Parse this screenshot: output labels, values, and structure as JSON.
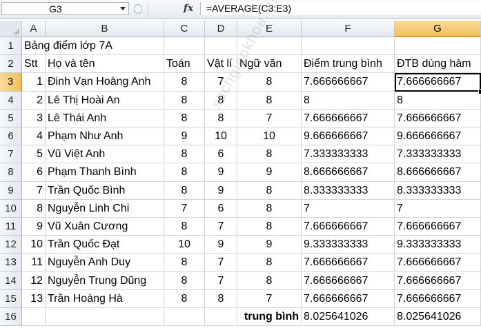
{
  "name_box": {
    "value": "G3"
  },
  "formula_bar": {
    "fx_label": "fx",
    "formula": "=AVERAGE(C3:E3)"
  },
  "columns": [
    "A",
    "B",
    "C",
    "D",
    "E",
    "F",
    "G"
  ],
  "active_column": "G",
  "active_row": 3,
  "rows": [
    {
      "num": "1",
      "cells": [
        "Bảng điểm lớp 7A",
        "",
        "",
        "",
        "",
        "",
        ""
      ]
    },
    {
      "num": "2",
      "cells": [
        "Stt",
        "Họ và tên",
        "Toán",
        "Vật lí",
        "Ngữ văn",
        "Điểm trung bình",
        "ĐTB dùng hàm"
      ]
    },
    {
      "num": "3",
      "cells": [
        "1",
        "Đinh Vạn Hoàng Anh",
        "8",
        "7",
        "8",
        "7.666666667",
        "7.666666667"
      ]
    },
    {
      "num": "4",
      "cells": [
        "2",
        "Lê Thị Hoài An",
        "8",
        "8",
        "8",
        "8",
        "8"
      ]
    },
    {
      "num": "5",
      "cells": [
        "3",
        "Lê Thái Anh",
        "8",
        "8",
        "7",
        "7.666666667",
        "7.666666667"
      ]
    },
    {
      "num": "6",
      "cells": [
        "4",
        "Phạm Như Anh",
        "9",
        "10",
        "10",
        "9.666666667",
        "9.666666667"
      ]
    },
    {
      "num": "7",
      "cells": [
        "5",
        "Vũ Việt Anh",
        "8",
        "6",
        "8",
        "7.333333333",
        "7.333333333"
      ]
    },
    {
      "num": "8",
      "cells": [
        "6",
        "Phạm Thanh Bình",
        "8",
        "9",
        "9",
        "8.666666667",
        "8.666666667"
      ]
    },
    {
      "num": "9",
      "cells": [
        "7",
        "Trần Quốc Bình",
        "8",
        "9",
        "8",
        "8.333333333",
        "8.333333333"
      ]
    },
    {
      "num": "10",
      "cells": [
        "8",
        "Nguyễn Linh Chi",
        "7",
        "6",
        "8",
        "7",
        "7"
      ]
    },
    {
      "num": "11",
      "cells": [
        "9",
        "Vũ Xuân Cương",
        "8",
        "7",
        "8",
        "7.666666667",
        "7.666666667"
      ]
    },
    {
      "num": "12",
      "cells": [
        "10",
        "Trần Quốc Đạt",
        "10",
        "9",
        "9",
        "9.333333333",
        "9.333333333"
      ]
    },
    {
      "num": "13",
      "cells": [
        "11",
        "Nguyễn Anh Duy",
        "8",
        "7",
        "8",
        "7.666666667",
        "7.666666667"
      ]
    },
    {
      "num": "14",
      "cells": [
        "12",
        "Nguyễn Trung Dũng",
        "8",
        "7",
        "8",
        "7.666666667",
        "7.666666667"
      ]
    },
    {
      "num": "15",
      "cells": [
        "13",
        "Trần Hoàng Hà",
        "8",
        "8",
        "7",
        "7.666666667",
        "7.666666667"
      ]
    },
    {
      "num": "16",
      "cells": [
        "",
        "",
        "",
        "",
        "trung bình",
        "8.025641026",
        "8.025641026"
      ]
    }
  ],
  "watermark": "sachgiaokhoa.info"
}
